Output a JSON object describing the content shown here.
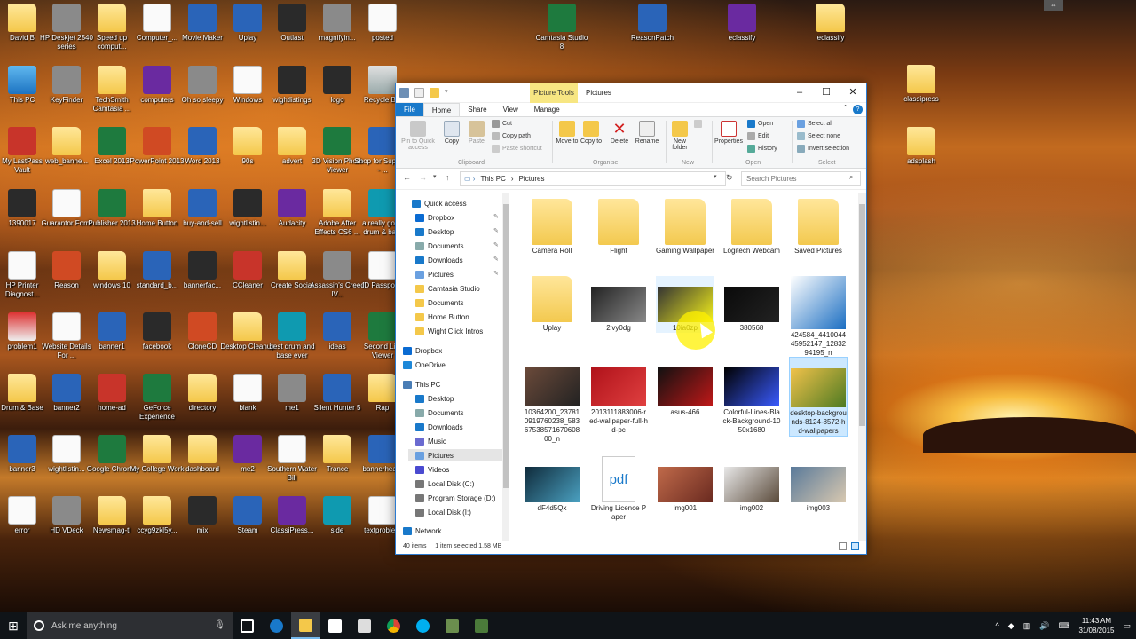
{
  "desktop_icons": [
    {
      "label": "David B",
      "kind": "folder"
    },
    {
      "label": "HP Deskjet 2540 series",
      "kind": "gray"
    },
    {
      "label": "Speed up comput...",
      "kind": "folder"
    },
    {
      "label": "Computer_...",
      "kind": "doc"
    },
    {
      "label": "Movie Maker",
      "kind": "blue"
    },
    {
      "label": "Uplay",
      "kind": "blue"
    },
    {
      "label": "Outlast",
      "kind": "dark"
    },
    {
      "label": "magnifyin...",
      "kind": "gray"
    },
    {
      "label": "posted",
      "kind": "doc"
    },
    {
      "label": "This PC",
      "kind": "pc"
    },
    {
      "label": "KeyFinder",
      "kind": "gray"
    },
    {
      "label": "TechSmith Camtasia ...",
      "kind": "folder"
    },
    {
      "label": "computers",
      "kind": "purple"
    },
    {
      "label": "Oh so sleepy",
      "kind": "gray"
    },
    {
      "label": "Windows",
      "kind": "doc"
    },
    {
      "label": "wightlistings",
      "kind": "dark"
    },
    {
      "label": "logo",
      "kind": "dark"
    },
    {
      "label": "Recycle Bin",
      "kind": "bin"
    },
    {
      "label": "My LastPass Vault",
      "kind": "red"
    },
    {
      "label": "web_banne...",
      "kind": "folder"
    },
    {
      "label": "Excel 2013",
      "kind": "green"
    },
    {
      "label": "PowerPoint 2013",
      "kind": "orange"
    },
    {
      "label": "Word 2013",
      "kind": "blue"
    },
    {
      "label": "90s",
      "kind": "folder"
    },
    {
      "label": "advert",
      "kind": "folder"
    },
    {
      "label": "3D Vision Photo Viewer",
      "kind": "green"
    },
    {
      "label": "Shop for Supplies - ...",
      "kind": "blue"
    },
    {
      "label": "1390017",
      "kind": "dark"
    },
    {
      "label": "Guarantor Form",
      "kind": "doc"
    },
    {
      "label": "Publisher 2013",
      "kind": "green"
    },
    {
      "label": "Home Button",
      "kind": "folder"
    },
    {
      "label": "buy-and-sell",
      "kind": "blue"
    },
    {
      "label": "wightlistin...",
      "kind": "dark"
    },
    {
      "label": "Audacity",
      "kind": "purple"
    },
    {
      "label": "Adobe After Effects CS6 ...",
      "kind": "folder"
    },
    {
      "label": "a really good drum & ba...",
      "kind": "teal"
    },
    {
      "label": "HP Printer Diagnost...",
      "kind": "doc"
    },
    {
      "label": "Reason",
      "kind": "orange"
    },
    {
      "label": "windows 10",
      "kind": "folder"
    },
    {
      "label": "standard_b...",
      "kind": "blue"
    },
    {
      "label": "bannerfac...",
      "kind": "dark"
    },
    {
      "label": "CCleaner",
      "kind": "red"
    },
    {
      "label": "Create Social",
      "kind": "folder"
    },
    {
      "label": "Assassin's Creed IV...",
      "kind": "gray"
    },
    {
      "label": "ID Passports",
      "kind": "doc"
    },
    {
      "label": "problem1",
      "kind": "img"
    },
    {
      "label": "Website Details For ...",
      "kind": "doc"
    },
    {
      "label": "banner1",
      "kind": "blue"
    },
    {
      "label": "facebook",
      "kind": "dark"
    },
    {
      "label": "CloneCD",
      "kind": "orange"
    },
    {
      "label": "Desktop Cleanup",
      "kind": "folder"
    },
    {
      "label": "best drum and base ever",
      "kind": "teal"
    },
    {
      "label": "ideas",
      "kind": "blue"
    },
    {
      "label": "Second Life Viewer",
      "kind": "green"
    },
    {
      "label": "Drum & Base",
      "kind": "folder"
    },
    {
      "label": "banner2",
      "kind": "blue"
    },
    {
      "label": "home-ad",
      "kind": "red"
    },
    {
      "label": "GeForce Experience",
      "kind": "green"
    },
    {
      "label": "directory",
      "kind": "folder"
    },
    {
      "label": "blank",
      "kind": "doc"
    },
    {
      "label": "me1",
      "kind": "gray"
    },
    {
      "label": "Silent Hunter 5",
      "kind": "blue"
    },
    {
      "label": "Rap",
      "kind": "folder"
    },
    {
      "label": "banner3",
      "kind": "blue"
    },
    {
      "label": "wightlistin...",
      "kind": "doc"
    },
    {
      "label": "Google Chrome",
      "kind": "green"
    },
    {
      "label": "My College Work",
      "kind": "folder"
    },
    {
      "label": "dashboard",
      "kind": "folder"
    },
    {
      "label": "me2",
      "kind": "purple"
    },
    {
      "label": "Southern Water Bill",
      "kind": "doc"
    },
    {
      "label": "Trance",
      "kind": "folder"
    },
    {
      "label": "bannerhea...",
      "kind": "blue"
    },
    {
      "label": "error",
      "kind": "doc"
    },
    {
      "label": "HD VDeck",
      "kind": "gray"
    },
    {
      "label": "Newsmag-tl",
      "kind": "folder"
    },
    {
      "label": "ccyg9zkl5y...",
      "kind": "folder"
    },
    {
      "label": "mix",
      "kind": "dark"
    },
    {
      "label": "Steam",
      "kind": "blue"
    },
    {
      "label": "ClassiPress...",
      "kind": "purple"
    },
    {
      "label": "side",
      "kind": "teal"
    },
    {
      "label": "textproblem",
      "kind": "doc"
    },
    {
      "label": "Camtasia Studio 8",
      "kind": "green"
    },
    {
      "label": "ReasonPatch",
      "kind": "blue"
    },
    {
      "label": "eclassify",
      "kind": "purple"
    },
    {
      "label": "eclassify",
      "kind": "folder"
    },
    {
      "label": "classipress",
      "kind": "folder"
    },
    {
      "label": "adsplash",
      "kind": "folder"
    }
  ],
  "window": {
    "context_tab": "Picture Tools",
    "title": "Pictures",
    "tabs": [
      "File",
      "Home",
      "Share",
      "View",
      "Manage"
    ],
    "ribbon": {
      "pin": "Pin to Quick access",
      "copy": "Copy",
      "paste": "Paste",
      "cut": "Cut",
      "copy_path": "Copy path",
      "paste_shortcut": "Paste shortcut",
      "move_to": "Move to",
      "copy_to": "Copy to",
      "delete": "Delete",
      "rename": "Rename",
      "new_folder": "New folder",
      "properties": "Properties",
      "open": "Open",
      "edit": "Edit",
      "history": "History",
      "select_all": "Select all",
      "select_none": "Select none",
      "invert": "Invert selection",
      "groups": [
        "Clipboard",
        "Organise",
        "New",
        "Open",
        "Select"
      ]
    },
    "address": [
      "This PC",
      "Pictures"
    ],
    "search_placeholder": "Search Pictures",
    "nav": [
      {
        "label": "Quick access",
        "pin": false,
        "sel": false
      },
      {
        "label": "Dropbox",
        "pin": true,
        "sel": false
      },
      {
        "label": "Desktop",
        "pin": true,
        "sel": false
      },
      {
        "label": "Documents",
        "pin": true,
        "sel": false
      },
      {
        "label": "Downloads",
        "pin": true,
        "sel": false
      },
      {
        "label": "Pictures",
        "pin": true,
        "sel": false
      },
      {
        "label": "Camtasia Studio",
        "pin": false,
        "sel": false
      },
      {
        "label": "Documents",
        "pin": false,
        "sel": false
      },
      {
        "label": "Home Button",
        "pin": false,
        "sel": false
      },
      {
        "label": "Wight Click Intros",
        "pin": false,
        "sel": false
      },
      {
        "label": "Dropbox",
        "pin": false,
        "sel": false
      },
      {
        "label": "OneDrive",
        "pin": false,
        "sel": false
      },
      {
        "label": "This PC",
        "pin": false,
        "sel": false
      },
      {
        "label": "Desktop",
        "pin": false,
        "sel": false
      },
      {
        "label": "Documents",
        "pin": false,
        "sel": false
      },
      {
        "label": "Downloads",
        "pin": false,
        "sel": false
      },
      {
        "label": "Music",
        "pin": false,
        "sel": false
      },
      {
        "label": "Pictures",
        "pin": false,
        "sel": true
      },
      {
        "label": "Videos",
        "pin": false,
        "sel": false
      },
      {
        "label": "Local Disk (C:)",
        "pin": false,
        "sel": false
      },
      {
        "label": "Program Storage (D:)",
        "pin": false,
        "sel": false
      },
      {
        "label": "Local Disk (I:)",
        "pin": false,
        "sel": false
      },
      {
        "label": "Network",
        "pin": false,
        "sel": false
      }
    ],
    "files": [
      {
        "name": "Camera Roll",
        "type": "folder"
      },
      {
        "name": "Flight",
        "type": "folder"
      },
      {
        "name": "Gaming Wallpaper",
        "type": "folder"
      },
      {
        "name": "Logitech Webcam",
        "type": "folder"
      },
      {
        "name": "Saved Pictures",
        "type": "folder"
      },
      {
        "name": "Uplay",
        "type": "folder"
      },
      {
        "name": "2lvy0dg",
        "type": "img",
        "colors": [
          "#222",
          "#888"
        ]
      },
      {
        "name": "10ia0zp",
        "type": "img",
        "colors": [
          "#333",
          "#f2ee1c"
        ]
      },
      {
        "name": "380568",
        "type": "img",
        "colors": [
          "#0a0a0a",
          "#222"
        ]
      },
      {
        "name": "424584_441004445952147_1283294195_n",
        "type": "img",
        "colors": [
          "#ffffff",
          "#1b6ec2"
        ]
      },
      {
        "name": "10364200_237810919760238_5836753857167060800_n",
        "type": "img",
        "colors": [
          "#6b4a3a",
          "#222"
        ]
      },
      {
        "name": "2013111883006-red-wallpaper-full-hd-pc",
        "type": "img",
        "colors": [
          "#b0121a",
          "#e04040"
        ]
      },
      {
        "name": "asus-466",
        "type": "img",
        "colors": [
          "#111",
          "#c01818"
        ]
      },
      {
        "name": "Colorful-Lines-Black-Background-1050x1680",
        "type": "img",
        "colors": [
          "#000",
          "#3a5bff"
        ]
      },
      {
        "name": "desktop-backgrounds-8124-8572-hd-wallpapers",
        "type": "img",
        "colors": [
          "#f1c24a",
          "#4d7a22"
        ]
      },
      {
        "name": "dF4d5Qx",
        "type": "img",
        "colors": [
          "#0f2a3a",
          "#4aa0c0"
        ]
      },
      {
        "name": "Driving Licence Paper",
        "type": "pdf"
      },
      {
        "name": "img001",
        "type": "img",
        "colors": [
          "#c06a4a",
          "#6a2a20"
        ]
      },
      {
        "name": "img002",
        "type": "img",
        "colors": [
          "#e8e8e8",
          "#5a4a3a"
        ]
      },
      {
        "name": "img003",
        "type": "img",
        "colors": [
          "#5a7a9a",
          "#d8c8b0"
        ]
      }
    ],
    "status": {
      "count": "40 items",
      "selected": "1 item selected  1.58 MB"
    }
  },
  "taskbar": {
    "search_placeholder": "Ask me anything",
    "time": "11:43 AM",
    "date": "31/08/2015"
  }
}
